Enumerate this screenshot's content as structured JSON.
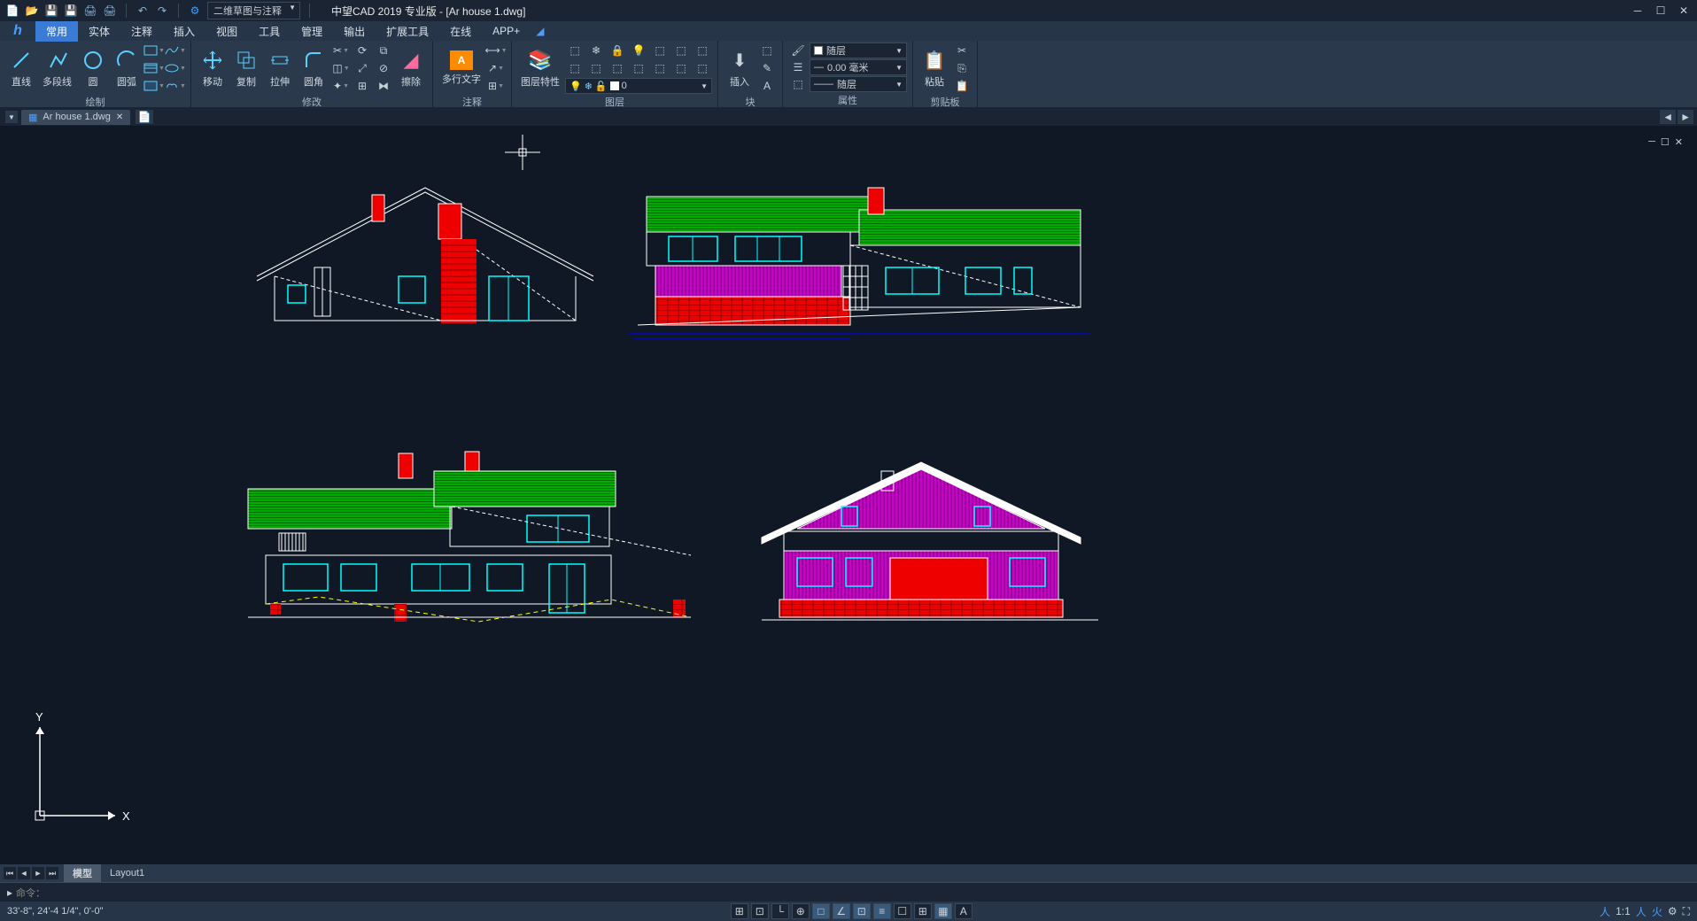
{
  "title": "中望CAD 2019 专业版 - [Ar house 1.dwg]",
  "workspace_selector": "二维草图与注释",
  "menu": [
    "常用",
    "实体",
    "注释",
    "插入",
    "视图",
    "工具",
    "管理",
    "输出",
    "扩展工具",
    "在线",
    "APP+"
  ],
  "active_menu": 0,
  "ribbon": {
    "draw": {
      "title": "绘制",
      "line": "直线",
      "pline": "多段线",
      "circle": "圆",
      "arc": "圆弧"
    },
    "modify": {
      "title": "修改",
      "move": "移动",
      "copy": "复制",
      "stretch": "拉伸",
      "fillet": "圆角",
      "erase": "擦除"
    },
    "annotate": {
      "title": "注释",
      "mtext": "多行文字"
    },
    "layers": {
      "title": "图层",
      "props": "图层特性",
      "current": "0"
    },
    "block": {
      "title": "块",
      "insert": "插入"
    },
    "properties": {
      "title": "属性",
      "bylayer": "随层",
      "lineweight": "0.00 毫米",
      "linetype": "随层"
    },
    "clipboard": {
      "title": "剪贴板",
      "paste": "粘贴"
    }
  },
  "doc_tab": "Ar house 1.dwg",
  "layout_tabs": {
    "model": "模型",
    "layout": "Layout1"
  },
  "cmd_prompt": "命令：",
  "coords": "33'-8\", 24'-4 1/4\", 0'-0\"",
  "ucs": {
    "x": "X",
    "y": "Y"
  },
  "scale_label": "1:1"
}
